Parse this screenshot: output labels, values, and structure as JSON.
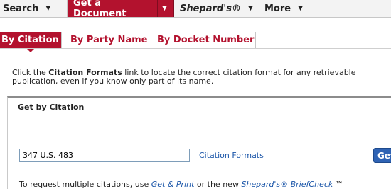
{
  "navbar": {
    "search_label": "Search",
    "get_document_label": "Get a Document",
    "shepards_label": "Shepard's®",
    "more_label": "More",
    "dropdown_glyph": "▼"
  },
  "subnav": {
    "by_citation": "By Citation",
    "by_party_name": "By Party Name",
    "by_docket_number": "By Docket Number"
  },
  "instructions": {
    "prefix": "Click the ",
    "bold": "Citation Formats",
    "suffix": " link to locate the correct citation format for any retrievable publication, even if you know only part of its name."
  },
  "section": {
    "title": "Get by Citation"
  },
  "form": {
    "citation_value": "347 U.S. 483",
    "formats_link": "Citation Formats",
    "get_button": "Get"
  },
  "footer": {
    "prefix": "To request multiple citations, use ",
    "link1": "Get & Print",
    "middle": " or the new ",
    "link2": "Shepard's® BriefCheck",
    "suffix": " ™"
  },
  "colors": {
    "accent": "#b3122e",
    "link": "#1a55a8",
    "button": "#2f63b4"
  }
}
